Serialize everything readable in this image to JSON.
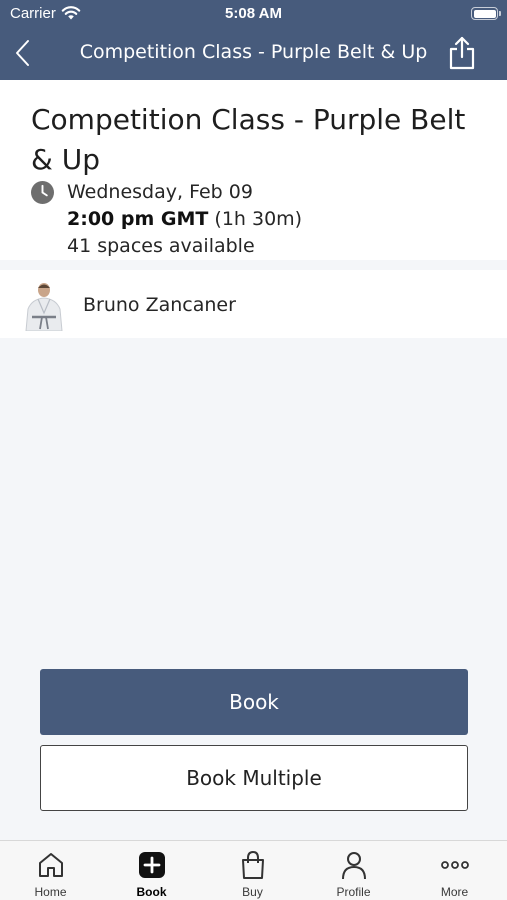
{
  "status_bar": {
    "carrier": "Carrier",
    "time": "5:08 AM"
  },
  "nav": {
    "title": "Competition Class - Purple Belt & Up",
    "back_icon": "chevron-left-icon",
    "share_icon": "share-icon"
  },
  "class_info": {
    "title": "Competition Class - Purple Belt & Up",
    "date": "Wednesday, Feb 09",
    "time": "2:00 pm GMT",
    "duration": "(1h 30m)",
    "spaces": "41 spaces available"
  },
  "instructor": {
    "name": "Bruno Zancaner"
  },
  "actions": {
    "book": "Book",
    "book_multiple": "Book Multiple"
  },
  "tabs": [
    {
      "label": "Home",
      "icon": "home-icon"
    },
    {
      "label": "Book",
      "icon": "plus-square-icon",
      "active": true
    },
    {
      "label": "Buy",
      "icon": "shopping-bag-icon"
    },
    {
      "label": "Profile",
      "icon": "person-icon"
    },
    {
      "label": "More",
      "icon": "more-dots-icon"
    }
  ],
  "colors": {
    "primary": "#475b7c",
    "background": "#f4f6f9",
    "card": "#ffffff"
  }
}
